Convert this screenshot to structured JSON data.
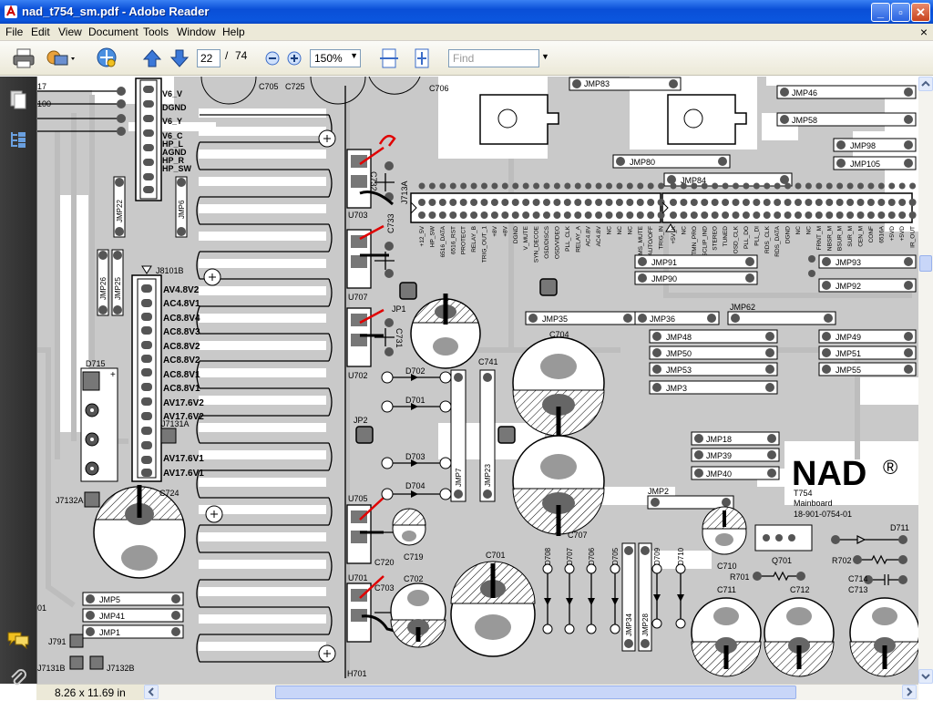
{
  "window": {
    "title": "nad_t754_sm.pdf - Adobe Reader",
    "controls": {
      "minimize": "_",
      "maximize": "▫",
      "close": "✕"
    }
  },
  "menu": {
    "items": [
      "File",
      "Edit",
      "View",
      "Document",
      "Tools",
      "Window",
      "Help"
    ],
    "close_document": "×"
  },
  "toolbar": {
    "page_current": "22",
    "page_separator": "/",
    "page_total": "74",
    "zoom": "150%",
    "find_placeholder": "Find",
    "icons": [
      "print-icon",
      "print-options-icon",
      "share-icon",
      "prev-page-icon",
      "next-page-icon",
      "zoom-out-icon",
      "zoom-in-icon",
      "fit-width-icon",
      "fit-page-icon"
    ]
  },
  "sidepanel": {
    "icons": [
      "pages-icon",
      "bookmarks-icon",
      "comments-icon",
      "attachments-icon"
    ]
  },
  "status": {
    "page_size": "8.26 x 11.69 in"
  },
  "colors": {
    "titlebar": "#0a4fd7",
    "pcb_trace": "#c8c8c8",
    "component": "#000000",
    "annotation": "#e00000"
  },
  "schematic": {
    "left_connector_labels": [
      "V6_V",
      "DGND",
      "V6_Y",
      "V6_C",
      "HP_L",
      "AGND",
      "HP_R",
      "HP_SW"
    ],
    "power_labels": [
      "AV4.8V2",
      "AC4.8V1",
      "AC8.8V4",
      "AC8.8V3",
      "AC8.8V2",
      "AC8.8V2",
      "AC8.8V1",
      "AC8.8V1",
      "AV17.6V2",
      "AV17.6V2",
      "AV17.6V1",
      "AV17.6V1"
    ],
    "left_partials": [
      "17",
      "100",
      "01"
    ],
    "component_labels": {
      "c705": "C705",
      "c725": "C725",
      "c706": "C706",
      "j8101b": "J8101B",
      "d715": "D715",
      "j7131a": "J7131A",
      "j7132a": "J7132A",
      "c724": "C724",
      "j7131b": "J7131B",
      "j7132b": "J7132B",
      "jmp26": "JMP26",
      "jmp22": "JMP22",
      "jmp6": "JMP6",
      "jmp25": "JMP25",
      "jmp5": "JMP5",
      "jmp41": "JMP41",
      "jmp1": "JMP1",
      "j791": "J791",
      "u703": "U703",
      "c732": "C732",
      "c733": "C733",
      "u707": "U707",
      "j713a": "J713A",
      "jp1": "JP1",
      "c731": "C731",
      "u702": "U702",
      "d702": "D702",
      "d701": "D701",
      "c741": "C741",
      "jp2": "JP2",
      "d703": "D703",
      "d704": "D704",
      "jmp7": "JMP7",
      "jmp23": "JMP23",
      "u705": "U705",
      "c720": "C720",
      "c719": "C719",
      "u701": "U701",
      "c703": "C703",
      "c702": "C702",
      "h701": "H701",
      "c701": "C701",
      "d708": "D708",
      "d707": "D707",
      "d706": "D706",
      "d705": "D705",
      "d709": "D709",
      "d710": "D710",
      "jmp34": "JMP34",
      "jmp28": "JMP28",
      "c704": "C704",
      "c707": "C707",
      "jmp83": "JMP83",
      "jmp80": "JMP80",
      "jmp84": "JMP84",
      "jmp46": "JMP46",
      "jmp58": "JMP58",
      "jmp98": "JMP98",
      "jmp105": "JMP105",
      "jmp91": "JMP91",
      "jmp90": "JMP90",
      "jmp93": "JMP93",
      "jmp92": "JMP92",
      "jmp35": "JMP35",
      "jmp36": "JMP36",
      "jmp62": "JMP62",
      "jmp48": "JMP48",
      "jmp50": "JMP50",
      "jmp53": "JMP53",
      "jmp3": "JMP3",
      "jmp49": "JMP49",
      "jmp51": "JMP51",
      "jmp55": "JMP55",
      "jmp18": "JMP18",
      "jmp39": "JMP39",
      "jmp40": "JMP40",
      "jmp2": "JMP2",
      "c710": "C710",
      "q701": "Q701",
      "r701": "R701",
      "r702": "R702",
      "d711": "D711",
      "c711": "C711",
      "c712": "C712",
      "c713": "C713",
      "c714": "C714"
    },
    "brand": "NAD",
    "registered": "®",
    "model": "T754",
    "board": "Mainboard",
    "part_number": "18-901-0754-01",
    "left_connector_pins": [
      "+12_5V",
      "HP_SW",
      "6516_DATA",
      "6516_RST",
      "PROTECT",
      "RELAY_B",
      "TRIG_OUT_1",
      "+8V",
      "+8V",
      "DGND",
      "V_MUTE",
      "SYN_DECOE",
      "OSD/DISCS",
      "OSD/VIDEO",
      "PLL_CLK",
      "RELAY_A",
      "AC4.8V",
      "AC4.8V",
      "NC",
      "NC",
      "NC",
      "MS_MUTE",
      "AUTO/OFF",
      "TRIG_IN"
    ],
    "right_connector_pins": [
      "+5V_K",
      "NC",
      "TMN_PRO",
      "SCLIP_IND",
      "STEREO",
      "TUNED",
      "OSD_CLK",
      "PLL_DO",
      "PLL_DI",
      "RDS_CLK",
      "RDS_DATA",
      "DGND",
      "NC",
      "NC",
      "FRNT_M",
      "NBSR_M",
      "BSUR_M",
      "SUR_M",
      "CEN_M",
      "CONF",
      "6516A",
      "+5VD",
      "+5VD",
      "IR_OUT",
      "IR_IN",
      "NC"
    ]
  }
}
